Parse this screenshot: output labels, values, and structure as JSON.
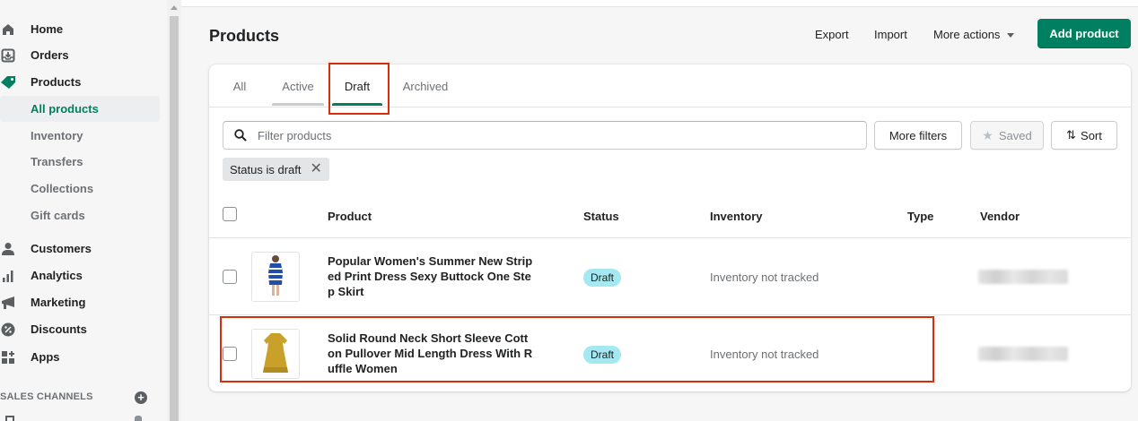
{
  "sidebar": {
    "items": [
      {
        "label": "Home",
        "icon": "home-icon"
      },
      {
        "label": "Orders",
        "icon": "orders-icon"
      },
      {
        "label": "Products",
        "icon": "tag-icon"
      },
      {
        "label": "All products"
      },
      {
        "label": "Inventory"
      },
      {
        "label": "Transfers"
      },
      {
        "label": "Collections"
      },
      {
        "label": "Gift cards"
      },
      {
        "label": "Customers",
        "icon": "person-icon"
      },
      {
        "label": "Analytics",
        "icon": "bar-chart-icon"
      },
      {
        "label": "Marketing",
        "icon": "megaphone-icon"
      },
      {
        "label": "Discounts",
        "icon": "discount-icon"
      },
      {
        "label": "Apps",
        "icon": "apps-icon"
      }
    ],
    "channels_label": "SALES CHANNELS"
  },
  "header": {
    "title": "Products",
    "export_label": "Export",
    "import_label": "Import",
    "more_actions_label": "More actions",
    "add_product_label": "Add product"
  },
  "tabs": [
    {
      "label": "All"
    },
    {
      "label": "Active"
    },
    {
      "label": "Draft"
    },
    {
      "label": "Archived"
    }
  ],
  "filters": {
    "search_placeholder": "Filter products",
    "more_filters_label": "More filters",
    "saved_label": "Saved",
    "sort_label": "Sort",
    "chip_label": "Status is draft"
  },
  "table": {
    "headers": {
      "product": "Product",
      "status": "Status",
      "inventory": "Inventory",
      "type": "Type",
      "vendor": "Vendor"
    },
    "rows": [
      {
        "name": "Popular Women's Summer New Striped Print Dress Sexy Buttock One Step Skirt",
        "status": "Draft",
        "inventory": "Inventory not tracked"
      },
      {
        "name": "Solid Round Neck Short Sleeve Cotton Pullover Mid Length Dress With Ruffle Women",
        "status": "Draft",
        "inventory": "Inventory not tracked"
      }
    ]
  },
  "colors": {
    "accent": "#008060",
    "badge": "#a4e8f2",
    "highlight": "#d82c0d"
  }
}
